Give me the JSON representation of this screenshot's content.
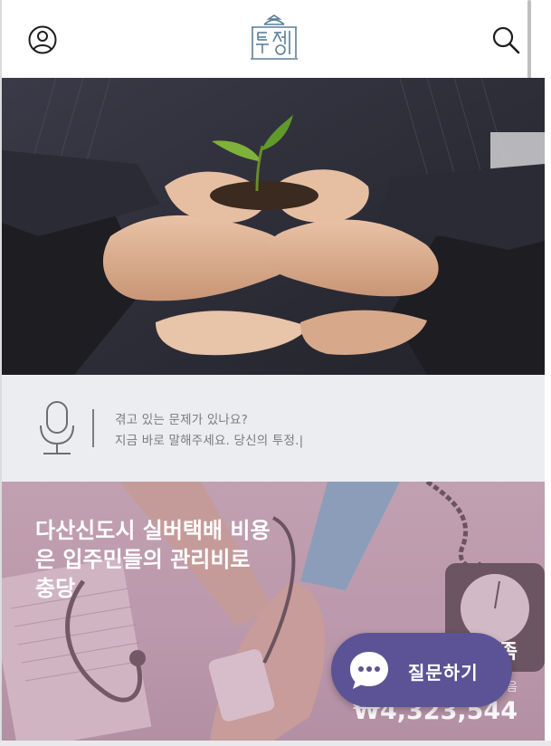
{
  "header": {
    "user_icon": "user-circle-icon",
    "logo_icon": "tujeong-logo-icon",
    "logo_text": "투정",
    "search_icon": "search-icon"
  },
  "hero": {
    "image_description": "hands-holding-seedling-image"
  },
  "voice_prompt": {
    "icon": "microphone-icon",
    "line1": "겪고 있는 문제가 있나요?",
    "line2": "지금 바로 말해주세요. 당신의 투정.",
    "caret": "|"
  },
  "article": {
    "title": "다산신도시 실버택배 비용은 입주민들의 관리비로 충당",
    "partial_heading": "족",
    "partial_label": "음",
    "amount": "₩4,323,544"
  },
  "floating_button": {
    "icon": "chat-bubble-dots-icon",
    "label": "질문하기"
  },
  "colors": {
    "button_bg": "#5b5396",
    "voice_bg": "#ecedf0",
    "card_tint": "#b898aa",
    "logo_stroke": "#5a7f99"
  }
}
